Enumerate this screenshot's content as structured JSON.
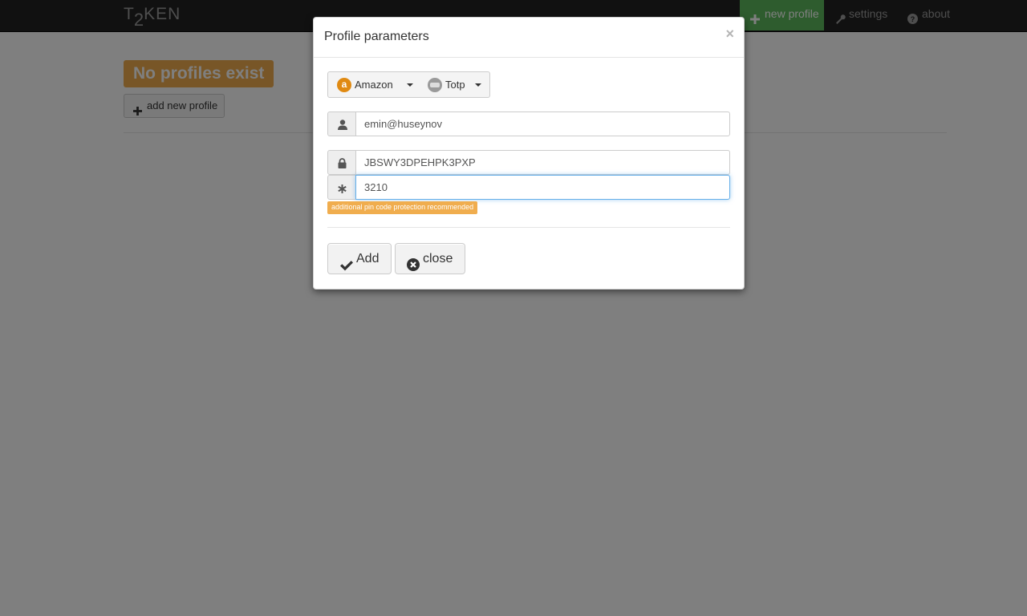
{
  "navbar": {
    "logo": {
      "part1": "T",
      "part2": "2",
      "part3": "KEN"
    },
    "items": [
      {
        "label": "new profile",
        "icon": "plus-icon"
      },
      {
        "label": "settings",
        "icon": "wrench-icon"
      },
      {
        "label": "about",
        "icon": "question-circle-icon"
      }
    ]
  },
  "main": {
    "status_label": "No profiles exist",
    "add_button_label": "add new profile"
  },
  "modal": {
    "title": "Profile parameters",
    "close_symbol": "×",
    "service_dropdown": {
      "label": "Amazon",
      "icon": "amazon-icon"
    },
    "type_dropdown": {
      "label": "Totp",
      "icon": "robot-icon"
    },
    "account_field": {
      "value": "emin@huseynov",
      "icon": "user-icon"
    },
    "secret_field": {
      "value": "JBSWY3DPEHPK3PXP",
      "icon": "lock-icon"
    },
    "pin_field": {
      "value": "3210",
      "icon": "asterisk-icon"
    },
    "pin_warning": "additional pin code protection recommended",
    "add_button": {
      "label": "Add",
      "icon": "check-icon"
    },
    "close_button": {
      "label": "close",
      "icon": "times-circle-icon"
    }
  },
  "colors": {
    "navbar_bg": "#222222",
    "active_nav": "#5cb85c",
    "warning": "#f0ad4e",
    "focus_border": "#66afe9"
  }
}
